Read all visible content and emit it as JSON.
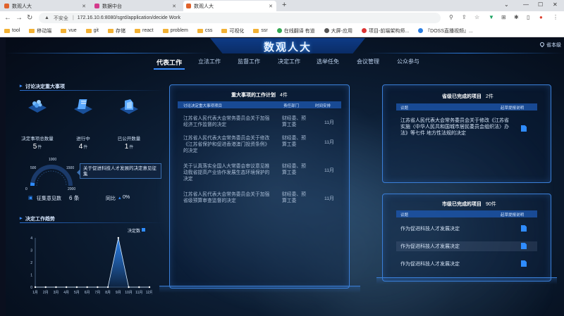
{
  "browser": {
    "tabs": [
      {
        "label": "数观人大",
        "color": "#e0622b"
      },
      {
        "label": "数据中台",
        "color": "#d43a8c"
      },
      {
        "label": "数观人大",
        "color": "#e0622b"
      }
    ],
    "url": "172.16.10.6:8080/sgrd/application/decide Work",
    "security": "不安全",
    "bookmarks": [
      {
        "label": "tool",
        "kind": "folder"
      },
      {
        "label": "移动端",
        "kind": "folder"
      },
      {
        "label": "vue",
        "kind": "folder"
      },
      {
        "label": "git",
        "kind": "folder"
      },
      {
        "label": "存储",
        "kind": "folder"
      },
      {
        "label": "react",
        "kind": "folder"
      },
      {
        "label": "problem",
        "kind": "folder"
      },
      {
        "label": "css",
        "kind": "folder"
      },
      {
        "label": "可视化",
        "kind": "folder"
      },
      {
        "label": "ssr",
        "kind": "folder"
      },
      {
        "label": "在线翻译 有道",
        "kind": "site"
      },
      {
        "label": "大屏-应用",
        "kind": "site"
      },
      {
        "label": "项目-前端架构师...",
        "kind": "site"
      },
      {
        "label": "『DOSS直播视频』...",
        "kind": "site"
      }
    ]
  },
  "app": {
    "title": "数观人大",
    "location": "省本级",
    "nav": [
      "代表工作",
      "立法工作",
      "监督工作",
      "决定工作",
      "选举任免",
      "会议管理",
      "公众参与"
    ],
    "active_nav": "代表工作"
  },
  "left": {
    "section1_title": "讨论决定重大事项",
    "stats": [
      {
        "label": "决定事项总数量",
        "value": "5",
        "unit": "件"
      },
      {
        "label": "进行中",
        "value": "4",
        "unit": "件"
      },
      {
        "label": "已公开数量",
        "value": "1",
        "unit": "件"
      }
    ],
    "gauge": {
      "min": "0",
      "max": "2000",
      "t1": "500",
      "t2": "1000",
      "t3": "1500",
      "value_fraction": 0.05
    },
    "topic": "关于促进科技人才发展的决定意见征集",
    "opinions_label": "征集意见数",
    "opinions_value": "6 条",
    "yoy_label": "同比",
    "yoy_value": "0%",
    "section2_title": "决定工作趋势"
  },
  "chart_data": {
    "type": "line",
    "legend": "决定数",
    "categories": [
      "1月",
      "2月",
      "3月",
      "4月",
      "5月",
      "6月",
      "7月",
      "8月",
      "9月",
      "10月",
      "11月",
      "12月"
    ],
    "series": [
      {
        "name": "决定数",
        "values": [
          0,
          0,
          0,
          0,
          0,
          0,
          0,
          0,
          4,
          0,
          0,
          0
        ]
      }
    ],
    "ylim": [
      0,
      4
    ],
    "yticks": [
      "0",
      "1",
      "2",
      "3",
      "4"
    ]
  },
  "center": {
    "title": "重大事项的工作计划",
    "count": "4件",
    "headers": [
      "讨论决定重大事项项目",
      "责任部门",
      "时间安排"
    ],
    "rows": [
      {
        "item": "江苏省人民代表大会常务委员会关于加强经济工作监督的决定",
        "dept": "财经委、预算工委",
        "time": "11月"
      },
      {
        "item": "江苏省人民代表大会常务委员会关于修改《江苏省保护和促进香港澳门投资条例》的决定",
        "dept": "财经委、预算工委",
        "time": "11月"
      },
      {
        "item": "关于认真落实全国人大常委会审议意见推动我省提高产业协作发展生态环境保护的决定",
        "dept": "财经委、预算工委",
        "time": "11月"
      },
      {
        "item": "江苏省人民代表大会常务委员会关于加强省级预算审查监督的决定",
        "dept": "财经委、预算工委",
        "time": "11月"
      }
    ]
  },
  "right_top": {
    "title": "省级已完成的项目",
    "count": "2件",
    "headers": [
      "议题",
      "起草提报说明"
    ],
    "rows": [
      {
        "text": "江苏省人民代表大会常务委员会关于修改《江苏省实施〈中华人民共和国城市居民委员会组织法〉办法》等七件 地方性法规的决定"
      }
    ]
  },
  "right_bottom": {
    "title": "市级已完成的项目",
    "count": "90件",
    "headers": [
      "议题",
      "起草提报说明"
    ],
    "rows": [
      {
        "text": "作为促进科技人才发展决定"
      },
      {
        "text": "作为促进科技人才发展决定"
      },
      {
        "text": "作为促进科技人才发展决定"
      }
    ]
  }
}
